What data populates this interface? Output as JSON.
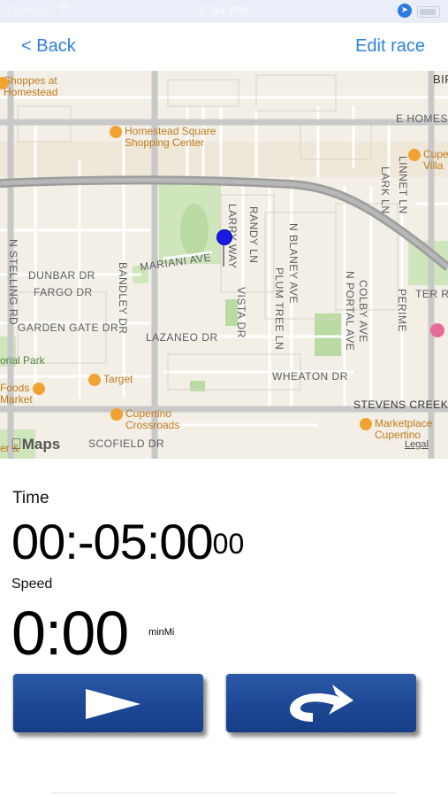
{
  "status_bar": {
    "carrier": "Carrier",
    "wifi_icon": "wifi-icon",
    "time": "8:34 PM",
    "location_icon": "location-arrow-icon",
    "battery_icon": "battery-icon"
  },
  "nav": {
    "back_label": "< Back",
    "edit_label": "Edit race"
  },
  "map": {
    "pois": {
      "shoppes": "Shoppes at\nHomestead",
      "homestead_square": "Homestead Square\nShopping Center",
      "cupertino_villa": "Cupe\nVilla",
      "target": "Target",
      "cupertino_crossroads": "Cupertino\nCrossroads",
      "marketplace": "Marketplace\nCupertino",
      "foods_market": "Foods\nMarket",
      "orial_park": "orial Park"
    },
    "streets": {
      "e_homestead": "E HOMEST",
      "bir": "BIR",
      "linnet": "LINNET LN",
      "lark": "LARK LN",
      "larry_way": "LARRY WAY",
      "randy": "RANDY LN",
      "n_blaney": "N BLANEY AVE",
      "n_stelling": "N STELLING RD",
      "mariani": "MARIANI AVE",
      "dunbar": "DUNBAR DR",
      "fargo": "FARGO DR",
      "bandley": "BANDLEY DR",
      "plum_tree": "PLUM TREE LN",
      "n_portal": "N PORTAL AVE",
      "colby": "COLBY AVE",
      "perimeter": "PERIME",
      "ter_rd": "TER RD",
      "garden_gate": "GARDEN GATE DR",
      "vista": "VISTA DR",
      "lazaneo": "LAZANEO DR",
      "wheaton": "WHEATON DR",
      "stevens_creek": "STEVENS CREEK B",
      "scofield": "SCOFIELD DR",
      "dumbar": "DUNBAR DR",
      "er": "er &"
    },
    "maps_logo": "Maps",
    "legal": "Legal"
  },
  "race": {
    "time_label": "Time",
    "time_value": "00:-05:00",
    "time_fraction": "00",
    "speed_label": "Speed",
    "speed_value": "0:00",
    "speed_unit": "minMi"
  },
  "colors": {
    "accent": "#2f7fe0",
    "button_blue": "#1e4a98",
    "pin_blue": "#1a1ae6"
  }
}
